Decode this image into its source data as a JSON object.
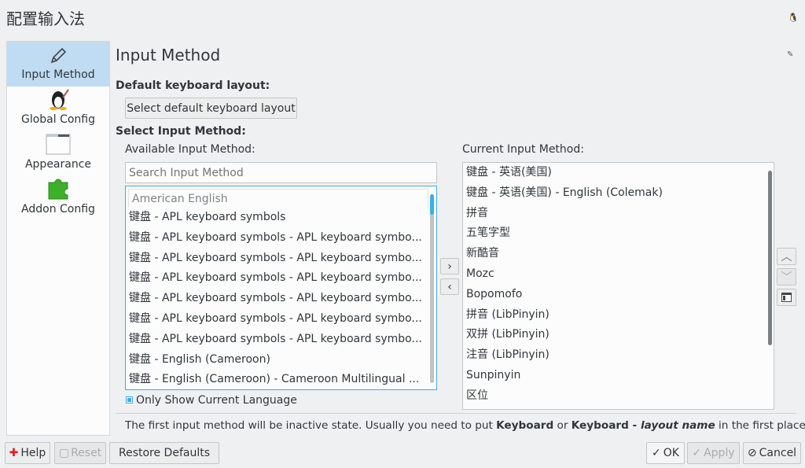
{
  "window": {
    "title": "配置输入法"
  },
  "sidebar": {
    "items": [
      {
        "label": "Input Method",
        "icon": "pencil-icon",
        "selected": true
      },
      {
        "label": "Global Config",
        "icon": "tux-penguin-icon"
      },
      {
        "label": "Appearance",
        "icon": "window-icon"
      },
      {
        "label": "Addon Config",
        "icon": "puzzle-piece-icon"
      }
    ]
  },
  "page": {
    "title": "Input Method",
    "default_layout_label": "Default keyboard layout:",
    "select_layout_button": "Select default keyboard layout",
    "select_im_label": "Select Input Method:",
    "available_label": "Available Input Method:",
    "current_label": "Current Input Method:",
    "search_placeholder": "Search Input Method",
    "available": {
      "group": "American English",
      "items": [
        "键盘 - APL keyboard symbols",
        "键盘 - APL keyboard symbols - APL keyboard symbo...",
        "键盘 - APL keyboard symbols - APL keyboard symbo...",
        "键盘 - APL keyboard symbols - APL keyboard symbo...",
        "键盘 - APL keyboard symbols - APL keyboard symbo...",
        "键盘 - APL keyboard symbols - APL keyboard symbo...",
        "键盘 - APL keyboard symbols - APL keyboard symbo...",
        "键盘 - English (Cameroon)",
        "键盘 - English (Cameroon) - Cameroon Multilingual ..."
      ]
    },
    "current": {
      "items": [
        "键盘 - 英语(美国)",
        "键盘 - 英语(美国) - English (Colemak)",
        "拼音",
        "五笔字型",
        "新酷音",
        "Mozc",
        "Bopomofo",
        "拼音 (LibPinyin)",
        "双拼 (LibPinyin)",
        "注音 (LibPinyin)",
        "Sunpinyin",
        "区位"
      ]
    },
    "only_current_language": "Only Show Current Language",
    "only_current_language_checked": true,
    "note": {
      "a": "The first input method will be inactive state. Usually you need to put ",
      "b": "Keyboard",
      "c": " or ",
      "d": "Keyboard - ",
      "e": "layout name",
      "f": " in the first place."
    }
  },
  "buttons": {
    "help": "Help",
    "reset": "Reset",
    "restore": "Restore Defaults",
    "ok": "OK",
    "apply": "Apply",
    "cancel": "Cancel"
  },
  "colors": {
    "accent": "#3daee9",
    "selected": "#bfdcf3",
    "background": "#eff0f1"
  }
}
